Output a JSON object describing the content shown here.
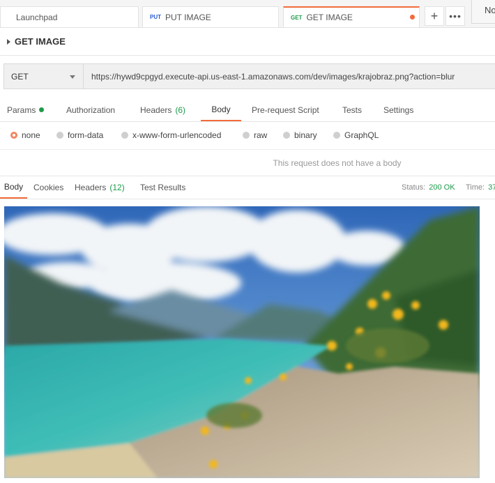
{
  "tabs": [
    {
      "label": "Launchpad"
    },
    {
      "method": "PUT",
      "label": "PUT IMAGE"
    },
    {
      "method": "GET",
      "label": "GET IMAGE"
    }
  ],
  "env_label": "No",
  "request": {
    "title": "GET IMAGE",
    "method": "GET",
    "url": "https://hywd9cpgyd.execute-api.us-east-1.amazonaws.com/dev/images/krajobraz.png?action=blur"
  },
  "request_tabs": {
    "params": "Params",
    "authorization": "Authorization",
    "headers": "Headers",
    "headers_count": "(6)",
    "body": "Body",
    "pre_request": "Pre-request Script",
    "tests": "Tests",
    "settings": "Settings"
  },
  "body_types": [
    "none",
    "form-data",
    "x-www-form-urlencoded",
    "raw",
    "binary",
    "GraphQL"
  ],
  "selected_body_type": "none",
  "no_body_message": "This request does not have a body",
  "response": {
    "tabs": {
      "body": "Body",
      "cookies": "Cookies",
      "headers": "Headers",
      "headers_count": "(12)",
      "test_results": "Test Results"
    },
    "status_label": "Status:",
    "status_value": "200 OK",
    "time_label": "Time:",
    "time_value": "37"
  },
  "colors": {
    "accent": "#f26b3a",
    "success": "#1d9b4a",
    "put_method": "#2a59d1"
  }
}
